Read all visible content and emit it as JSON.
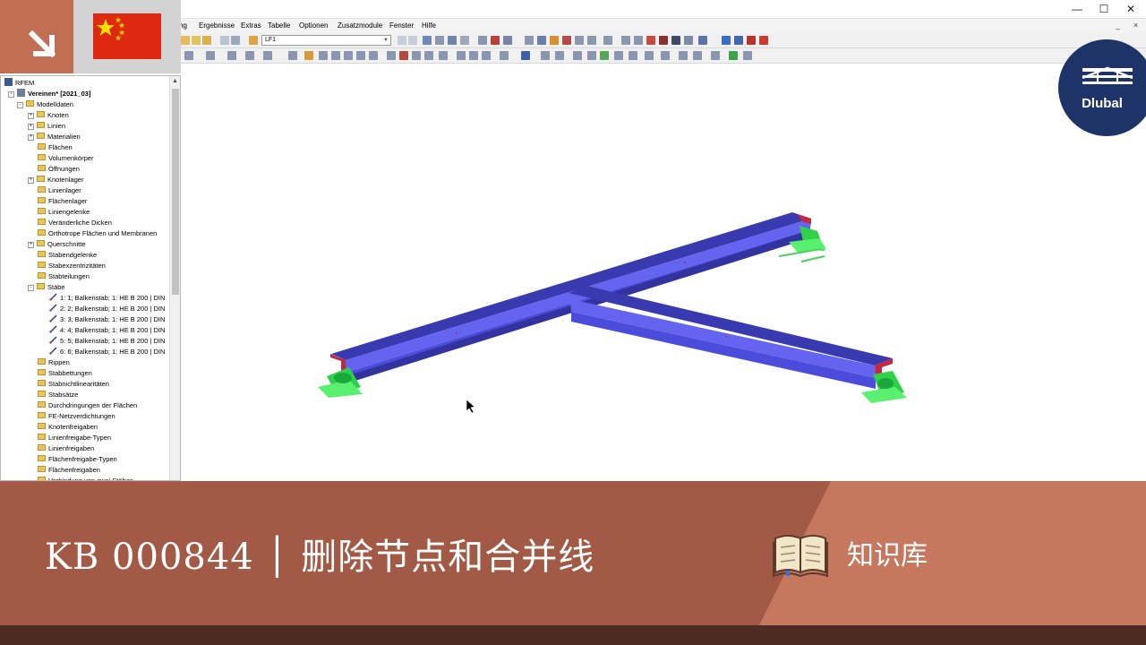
{
  "window": {
    "minimize": "—",
    "maximize": "☐",
    "close": "✕"
  },
  "menu": {
    "items": [
      "ng",
      "Ergebnisse",
      "Extras",
      "Tabelle",
      "Optionen",
      "Zusatzmodule",
      "Fenster",
      "Hilfe"
    ],
    "mdi_minimize": "_",
    "mdi_close": "×"
  },
  "toolbar": {
    "load_case": "LF1"
  },
  "navigator": {
    "root": "RFEM",
    "project": "Vereinen* [2021_03]",
    "items": [
      {
        "label": "Modelldaten",
        "level": 1,
        "expander": "-"
      },
      {
        "label": "Knoten",
        "level": 2,
        "expander": "+"
      },
      {
        "label": "Linien",
        "level": 2,
        "expander": "+"
      },
      {
        "label": "Materialien",
        "level": 2,
        "expander": "+"
      },
      {
        "label": "Flächen",
        "level": 2,
        "expander": ""
      },
      {
        "label": "Volumenkörper",
        "level": 2,
        "expander": ""
      },
      {
        "label": "Öffnungen",
        "level": 2,
        "expander": ""
      },
      {
        "label": "Knotenlager",
        "level": 2,
        "expander": "+"
      },
      {
        "label": "Linienlager",
        "level": 2,
        "expander": ""
      },
      {
        "label": "Flächenlager",
        "level": 2,
        "expander": ""
      },
      {
        "label": "Liniengelenke",
        "level": 2,
        "expander": ""
      },
      {
        "label": "Veränderliche Dicken",
        "level": 2,
        "expander": ""
      },
      {
        "label": "Orthotrope Flächen und Membranen",
        "level": 2,
        "expander": ""
      },
      {
        "label": "Querschnitte",
        "level": 2,
        "expander": "+"
      },
      {
        "label": "Stabendgelenke",
        "level": 2,
        "expander": ""
      },
      {
        "label": "Stabexzentrizitäten",
        "level": 2,
        "expander": ""
      },
      {
        "label": "Stabteilungen",
        "level": 2,
        "expander": ""
      },
      {
        "label": "Stäbe",
        "level": 2,
        "expander": "-"
      },
      {
        "label": "1: 1; Balkenstab; 1: HE B 200 | DIN",
        "level": 3,
        "expander": "",
        "member": true
      },
      {
        "label": "2: 2; Balkenstab; 1: HE B 200 | DIN",
        "level": 3,
        "expander": "",
        "member": true
      },
      {
        "label": "3: 3; Balkenstab; 1: HE B 200 | DIN",
        "level": 3,
        "expander": "",
        "member": true
      },
      {
        "label": "4: 4; Balkenstab; 1: HE B 200 | DIN",
        "level": 3,
        "expander": "",
        "member": true
      },
      {
        "label": "5: 5; Balkenstab; 1: HE B 200 | DIN",
        "level": 3,
        "expander": "",
        "member": true
      },
      {
        "label": "6: 6; Balkenstab; 1: HE B 200 | DIN",
        "level": 3,
        "expander": "",
        "member": true
      },
      {
        "label": "Rippen",
        "level": 2,
        "expander": ""
      },
      {
        "label": "Stabbettungen",
        "level": 2,
        "expander": ""
      },
      {
        "label": "Stabnichtlinearitäten",
        "level": 2,
        "expander": ""
      },
      {
        "label": "Stabsätze",
        "level": 2,
        "expander": ""
      },
      {
        "label": "Durchdringungen der Flächen",
        "level": 2,
        "expander": ""
      },
      {
        "label": "FE-Netzverdichtungen",
        "level": 2,
        "expander": ""
      },
      {
        "label": "Knotenfreigaben",
        "level": 2,
        "expander": ""
      },
      {
        "label": "Linienfreigabe-Typen",
        "level": 2,
        "expander": ""
      },
      {
        "label": "Linienfreigaben",
        "level": 2,
        "expander": ""
      },
      {
        "label": "Flächenfreigabe-Typen",
        "level": 2,
        "expander": ""
      },
      {
        "label": "Flächenfreigaben",
        "level": 2,
        "expander": ""
      },
      {
        "label": "Verbindung von zwei Stäben",
        "level": 2,
        "expander": ""
      }
    ]
  },
  "logo": {
    "text": "Dlubal"
  },
  "banner": {
    "title": "KB 000844 │ 删除节点和合并线",
    "category": "知识库",
    "book_icon": "open-book-icon"
  },
  "colors": {
    "accent": "#c26e55",
    "banner": "#a25a47",
    "beam": "#5b5be6",
    "support": "#3de65a",
    "logo": "#1e3468"
  }
}
